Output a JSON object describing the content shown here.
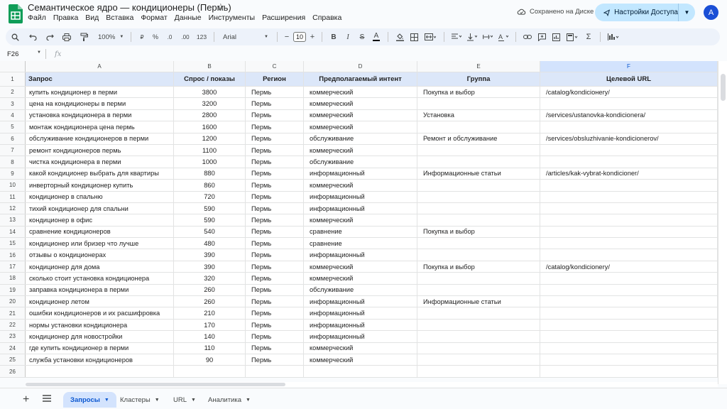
{
  "doc": {
    "title": "Семантическое ядро — кондиционеры (Пермь)",
    "menu": [
      "Файл",
      "Правка",
      "Вид",
      "Вставка",
      "Формат",
      "Данные",
      "Инструменты",
      "Расширения",
      "Справка"
    ],
    "saved_status": "Сохранено на Диске",
    "share_label": "Настройки Доступа",
    "avatar_letter": "A"
  },
  "toolbar": {
    "zoom": "100%",
    "currency": "₽",
    "percent": "%",
    "dec_less": ".0",
    "dec_more": ".00",
    "num_format": "123",
    "font": "Arial",
    "font_size": "10"
  },
  "formula_bar": {
    "cell_ref": "F26",
    "fx": "fx",
    "content": ""
  },
  "columns": [
    "A",
    "B",
    "C",
    "D",
    "E",
    "F"
  ],
  "header_row": {
    "num": "1",
    "cells": [
      "Запрос",
      "Спрос / показы",
      "Регион",
      "Предполагаемый интент",
      "Группа",
      "Целевой URL"
    ]
  },
  "rows": [
    {
      "n": "2",
      "q": "купить кондиционер в перми",
      "v": "3800",
      "r": "Пермь",
      "i": "коммерческий",
      "g": "Покупка и выбор",
      "u": "/catalog/kondiciонery/"
    },
    {
      "n": "3",
      "q": "цена на кондиционеры в перми",
      "v": "3200",
      "r": "Пермь",
      "i": "коммерческий",
      "g": "",
      "u": ""
    },
    {
      "n": "4",
      "q": "установка кондиционера в перми",
      "v": "2800",
      "r": "Пермь",
      "i": "коммерческий",
      "g": "Установка",
      "u": "/services/ustanovka-kondicionera/"
    },
    {
      "n": "5",
      "q": "монтаж кондиционера цена пермь",
      "v": "1600",
      "r": "Пермь",
      "i": "коммерческий",
      "g": "",
      "u": ""
    },
    {
      "n": "6",
      "q": "обслуживание кондиционеров в перми",
      "v": "1200",
      "r": "Пермь",
      "i": "обслуживание",
      "g": "Ремонт и обслуживание",
      "u": "/services/obsluzhivanie-kondicionerov/"
    },
    {
      "n": "7",
      "q": "ремонт кондиционеров пермь",
      "v": "1100",
      "r": "Пермь",
      "i": "коммерческий",
      "g": "",
      "u": ""
    },
    {
      "n": "8",
      "q": "чистка кондиционера в перми",
      "v": "1000",
      "r": "Пермь",
      "i": "обслуживание",
      "g": "",
      "u": ""
    },
    {
      "n": "9",
      "q": "какой кондиционер выбрать для квартиры",
      "v": "880",
      "r": "Пермь",
      "i": "информационный",
      "g": "Информационные статьи",
      "u": "/articles/kak-vybrat-kondicioner/"
    },
    {
      "n": "10",
      "q": "инверторный кондиционер купить",
      "v": "860",
      "r": "Пермь",
      "i": "коммерческий",
      "g": "",
      "u": ""
    },
    {
      "n": "11",
      "q": "кондиционер в спальню",
      "v": "720",
      "r": "Пермь",
      "i": "информационный",
      "g": "",
      "u": ""
    },
    {
      "n": "12",
      "q": "тихий кондиционер для спальни",
      "v": "590",
      "r": "Пермь",
      "i": "информационный",
      "g": "",
      "u": ""
    },
    {
      "n": "13",
      "q": "кондиционер в офис",
      "v": "590",
      "r": "Пермь",
      "i": "коммерческий",
      "g": "",
      "u": ""
    },
    {
      "n": "14",
      "q": "сравнение кондиционеров",
      "v": "540",
      "r": "Пермь",
      "i": "сравнение",
      "g": "Покупка и выбор",
      "u": ""
    },
    {
      "n": "15",
      "q": "кондиционер или бризер что лучше",
      "v": "480",
      "r": "Пермь",
      "i": "сравнение",
      "g": "",
      "u": ""
    },
    {
      "n": "16",
      "q": "отзывы о кондиционерах",
      "v": "390",
      "r": "Пермь",
      "i": "информационный",
      "g": "",
      "u": ""
    },
    {
      "n": "17",
      "q": "кондиционер для дома",
      "v": "390",
      "r": "Пермь",
      "i": "коммерческий",
      "g": "Покупка и выбор",
      "u": "/catalog/kondicionery/"
    },
    {
      "n": "18",
      "q": "сколько стоит установка кондиционера",
      "v": "320",
      "r": "Пермь",
      "i": "коммерческий",
      "g": "",
      "u": ""
    },
    {
      "n": "19",
      "q": "заправка кондиционера в перми",
      "v": "260",
      "r": "Пермь",
      "i": "обслуживание",
      "g": "",
      "u": ""
    },
    {
      "n": "20",
      "q": "кондиционер летом",
      "v": "260",
      "r": "Пермь",
      "i": "информационный",
      "g": "Информационные статьи",
      "u": ""
    },
    {
      "n": "21",
      "q": "ошибки кондиционеров и их расшифровка",
      "v": "210",
      "r": "Пермь",
      "i": "информационный",
      "g": "",
      "u": ""
    },
    {
      "n": "22",
      "q": "нормы установки кондиционера",
      "v": "170",
      "r": "Пермь",
      "i": "информационный",
      "g": "",
      "u": ""
    },
    {
      "n": "23",
      "q": "кондиционер для новостройки",
      "v": "140",
      "r": "Пермь",
      "i": "информационный",
      "g": "",
      "u": ""
    },
    {
      "n": "24",
      "q": "где купить кондиционер в перми",
      "v": "110",
      "r": "Пермь",
      "i": "коммерческий",
      "g": "",
      "u": ""
    },
    {
      "n": "25",
      "q": "служба установки кондиционеров",
      "v": "90",
      "r": "Пермь",
      "i": "коммерческий",
      "g": "",
      "u": ""
    },
    {
      "n": "26",
      "q": "",
      "v": "",
      "r": "",
      "i": "",
      "g": "",
      "u": ""
    }
  ],
  "sheets": [
    {
      "label": "Запросы",
      "active": true
    },
    {
      "label": "Кластеры",
      "active": false
    },
    {
      "label": "URL",
      "active": false
    },
    {
      "label": "Аналитика",
      "active": false
    }
  ]
}
